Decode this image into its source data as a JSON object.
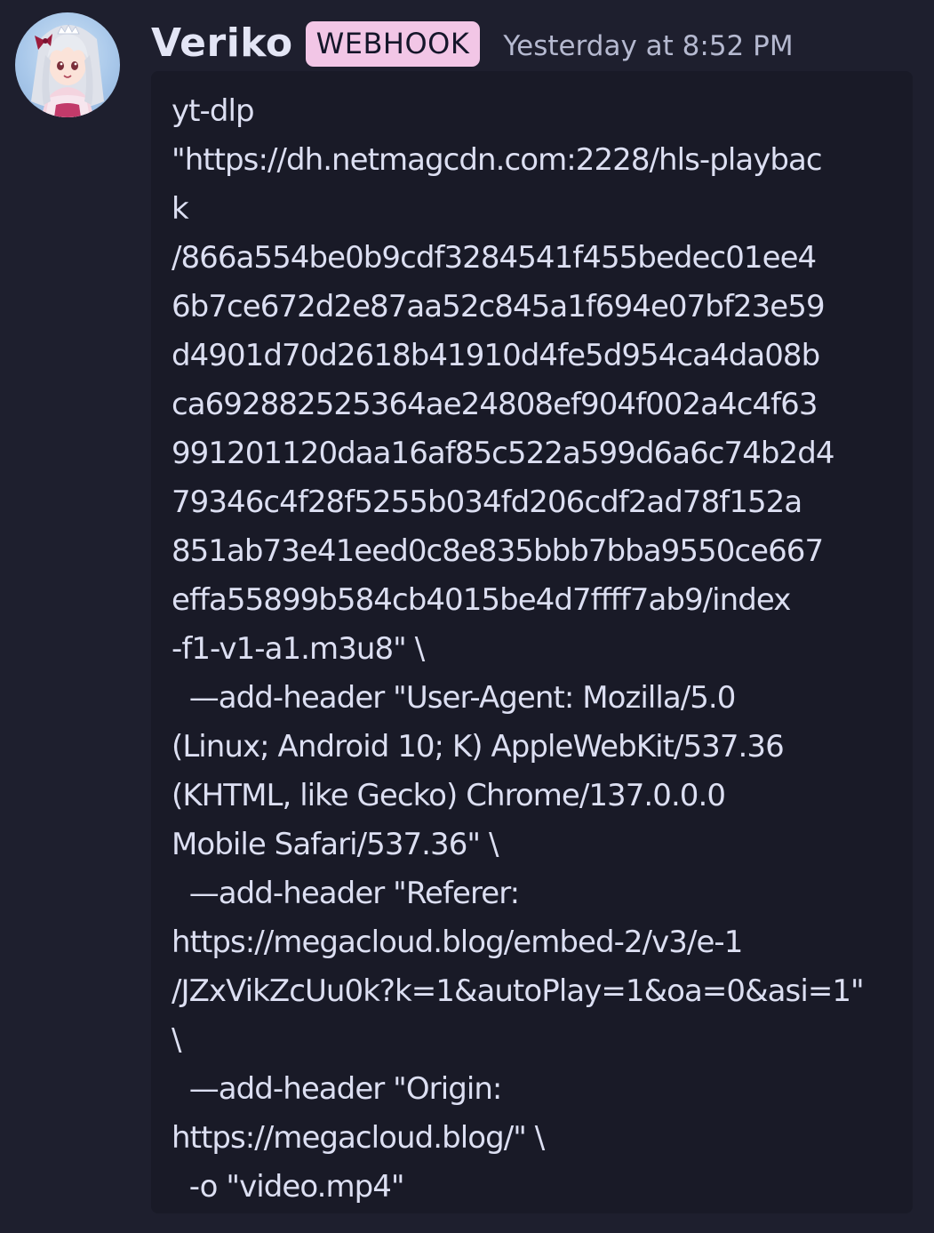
{
  "message": {
    "author": "Veriko",
    "badge": "WEBHOOK",
    "timestamp": "Yesterday at 8:52 PM",
    "code_lines": [
      "yt-dlp",
      "\"https://dh.netmagcdn.com:2228/hls-playbac",
      "k",
      "/866a554be0b9cdf3284541f455bedec01ee4",
      "6b7ce672d2e87aa52c845a1f694e07bf23e59",
      "d4901d70d2618b41910d4fe5d954ca4da08b",
      "ca692882525364ae24808ef904f002a4c4f63",
      "991201120daa16af85c522a599d6a6c74b2d4",
      "79346c4f28f5255b034fd206cdf2ad78f152a",
      "851ab73e41eed0c8e835bbb7bba9550ce667",
      "effa55899b584cb4015be4d7ffff7ab9/index",
      "-f1-v1-a1.m3u8\" \\",
      "  —add-header \"User-Agent: Mozilla/5.0",
      "(Linux; Android 10; K) AppleWebKit/537.36",
      "(KHTML, like Gecko) Chrome/137.0.0.0",
      "Mobile Safari/537.36\" \\",
      "  —add-header \"Referer:",
      "https://megacloud.blog/embed-2/v3/e-1",
      "/JZxVikZcUu0k?k=1&autoPlay=1&oa=0&asi=1\"",
      "\\",
      "  —add-header \"Origin:",
      "https://megacloud.blog/\" \\",
      "  -o \"video.mp4\""
    ]
  },
  "colors": {
    "background": "#1e1f2e",
    "code_background": "#191a27",
    "badge_background": "#f2c6e6",
    "username": "#e3e5f5",
    "timestamp": "#b5b9d0",
    "code_text": "#dcdff2"
  },
  "icons": {
    "avatar": "anime-girl-avatar"
  }
}
